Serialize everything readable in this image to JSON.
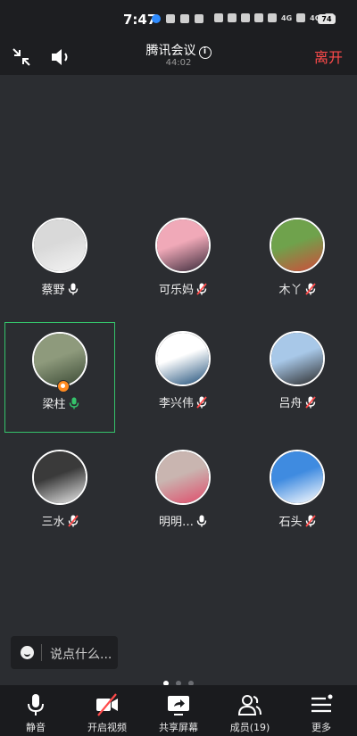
{
  "status_bar": {
    "time": "7:47",
    "network_1": "4G",
    "network_2": "4G",
    "battery": "74"
  },
  "header": {
    "title": "腾讯会议",
    "info_icon": "i",
    "duration": "44:02",
    "leave_label": "离开"
  },
  "participants": [
    {
      "name": "蔡野",
      "mic": "on",
      "colors": [
        "#d9d9d9",
        "#f4f4f4"
      ]
    },
    {
      "name": "可乐妈",
      "mic": "muted",
      "colors": [
        "#f0a9b8",
        "#3a2a3a"
      ]
    },
    {
      "name": "木丫",
      "mic": "muted",
      "colors": [
        "#6fa24c",
        "#d14b3a"
      ]
    },
    {
      "name": "梁柱",
      "mic": "active",
      "colors": [
        "#8e9a7c",
        "#3b4a35"
      ],
      "host": true
    },
    {
      "name": "李兴伟",
      "mic": "muted",
      "colors": [
        "#ffffff",
        "#1e4f7a"
      ]
    },
    {
      "name": "吕舟",
      "mic": "muted",
      "colors": [
        "#a8c8e8",
        "#2c2c2c"
      ]
    },
    {
      "name": "三水",
      "mic": "muted",
      "colors": [
        "#3a3a3a",
        "#e9e9e9"
      ]
    },
    {
      "name": "明明…",
      "mic": "on",
      "colors": [
        "#c9b5b0",
        "#e04b6a"
      ]
    },
    {
      "name": "石头",
      "mic": "muted",
      "colors": [
        "#3f8be0",
        "#ffffff"
      ]
    }
  ],
  "chat": {
    "placeholder": "说点什么..."
  },
  "pagination": {
    "pages": 3,
    "current": 1
  },
  "toolbar": {
    "mute_label": "静音",
    "video_label": "开启视频",
    "share_label": "共享屏幕",
    "members_label": "成员(19)",
    "more_label": "更多"
  },
  "colors": {
    "background": "#2b2d31",
    "bar": "#1d1e21",
    "leave": "#ff4b4b",
    "speaking": "#35c36b",
    "muted_slash": "#ff4b4b"
  }
}
